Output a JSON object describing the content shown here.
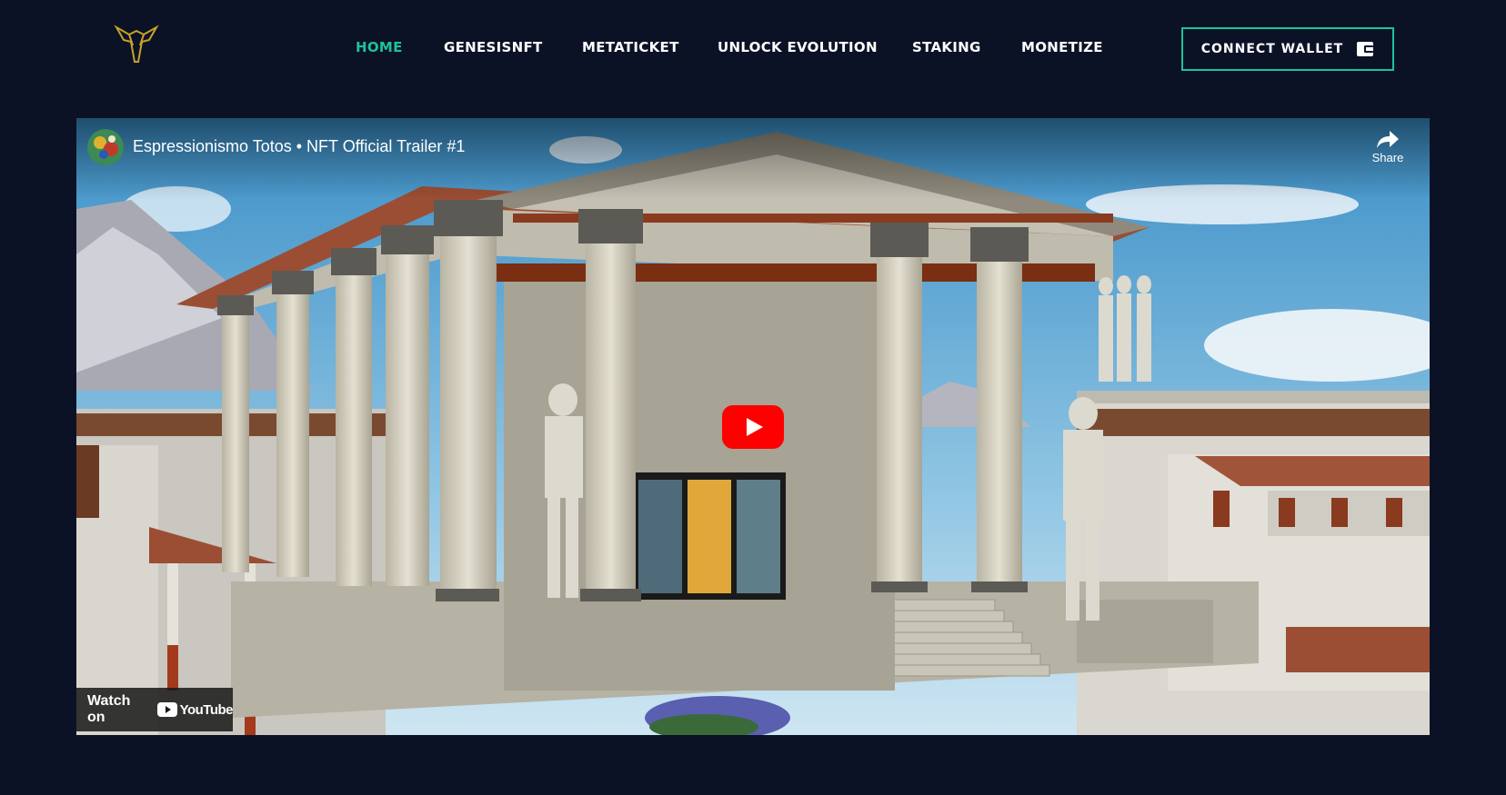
{
  "header": {
    "logo_icon": "goat-head-logo-icon",
    "nav": [
      {
        "label": "HOME",
        "active": true
      },
      {
        "label": "GENESISNFT",
        "active": false
      },
      {
        "label": "METATICKET",
        "active": false
      },
      {
        "label": "UNLOCK EVOLUTION",
        "active": false
      },
      {
        "label": "STAKING",
        "active": false
      },
      {
        "label": "MONETIZE",
        "active": false
      }
    ],
    "connect_label": "CONNECT WALLET",
    "connect_icon": "wallet-icon"
  },
  "video": {
    "title": "Espressionismo Totos • NFT Official Trailer #1",
    "share_label": "Share",
    "watch_on_label": "Watch on",
    "youtube_label": "YouTube"
  },
  "colors": {
    "background": "#0b1226",
    "accent": "#1fc29a",
    "youtube_red": "#ff0000"
  }
}
